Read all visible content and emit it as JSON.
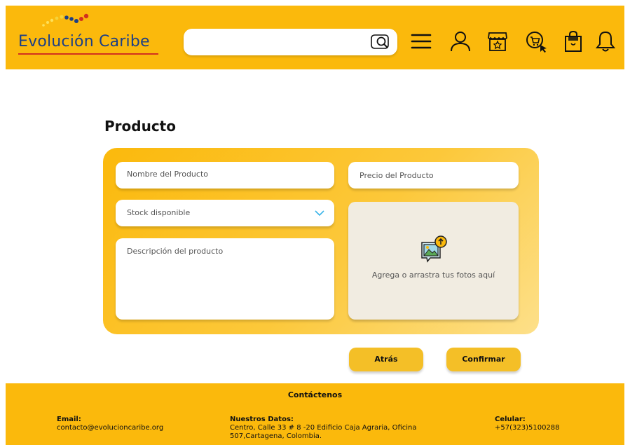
{
  "header": {
    "brand": "Evolución Caribe",
    "search_placeholder": "",
    "icons": [
      "search-icon",
      "menu-icon",
      "user-icon",
      "store-icon",
      "cart-icon",
      "shopping-bag-icon",
      "bell-icon"
    ]
  },
  "main": {
    "title": "Producto",
    "form": {
      "name_placeholder": "Nombre del Producto",
      "price_placeholder": "Precio del Producto",
      "stock_placeholder": "Stock disponible",
      "description_placeholder": "Descripción del producto",
      "dropzone_text": "Agrega o arrastra tus fotos aquí"
    },
    "buttons": {
      "back": "Atrás",
      "confirm": "Confirmar"
    }
  },
  "footer": {
    "title": "Contáctenos",
    "email_label": "Email:",
    "email_value": "contacto@evolucioncaribe.org",
    "data_label": "Nuestros Datos:",
    "data_value": "Centro, Calle 33 # 8 -20 Edificio Caja Agraria, Oficina 507,Cartagena, Colombia.",
    "phone_label": "Celular:",
    "phone_value": "+57(323)5100288"
  },
  "colors": {
    "brand_yellow": "#fbb90c",
    "brand_blue": "#1c3f86",
    "brand_red": "#d2311f",
    "button": "#f4bf27",
    "dropzone_bg": "#f1ece1"
  }
}
